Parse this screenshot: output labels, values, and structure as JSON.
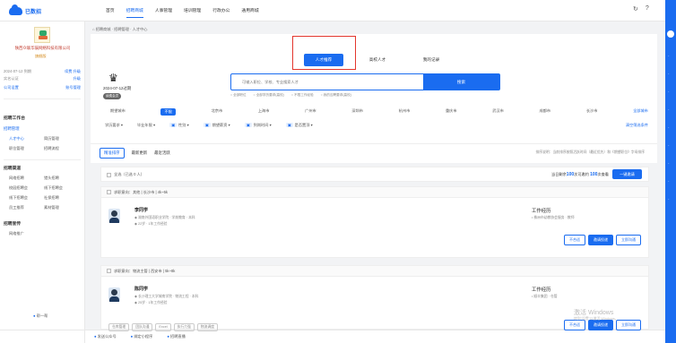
{
  "brand": {
    "logo_text": "已数招"
  },
  "nav": [
    "首页",
    "招聘商城",
    "人事管理",
    "培训管理",
    "行政办公",
    "通用商城"
  ],
  "nav_active_index": 1,
  "breadcrumb": "招聘商城 · 招聘管理 · 人才中心",
  "sidebar": {
    "company": "陕西众联华辰网络科技有限公司",
    "vip": "旗舰版",
    "date_row": {
      "left": "2024-07-12 到期",
      "right": "续费 升级"
    },
    "account_row": {
      "left": "实名认证",
      "right": "升级"
    },
    "btn_row": {
      "left": "公司设置",
      "right": "账号管理"
    },
    "section1": "招聘工作台",
    "sub1": "招聘管理",
    "grid1": [
      "人才中心",
      "简历管理",
      "职位管理",
      "招聘流程"
    ],
    "section2": "招聘渠道",
    "grid2": [
      "网络招聘",
      "猎头招聘",
      "校园招聘会",
      "线下招聘会",
      "线下招聘会",
      "社保招聘",
      "员工推荐",
      "素材管理"
    ],
    "section3": "招聘宣传",
    "grid3": [
      "网络推广"
    ],
    "bottom": "帮一帮"
  },
  "tabs": [
    "人才推荐",
    "高校人才",
    "我的记录"
  ],
  "tab_active_index": 0,
  "vip_panel": {
    "expire": "2024-07-12过期",
    "badge": "续费会员"
  },
  "search": {
    "placeholder": "可输入职位、学校、专业搜索人才",
    "button": "搜索"
  },
  "search_opts": [
    "全部职位",
    "全部学历要求(高校)",
    "不限工作经验",
    "我的应聘要求(高校)"
  ],
  "cities": [
    "期望城市",
    "不限",
    "北京市",
    "上海市",
    "广州市",
    "深圳市",
    "杭州市",
    "重庆市",
    "武汉市",
    "成都市",
    "长沙市",
    "全部城市"
  ],
  "filters": [
    "学历要求",
    "毕业年限",
    "性别",
    "期望薪资",
    "到岗时间",
    "是否置顶"
  ],
  "filter_adv": "清空筛选条件",
  "sort": {
    "buttons": [
      "精准排序",
      "最新更新",
      "最近活跃"
    ],
    "note": "排序说明：当前排序按照活跃时间（最近优先）和《期望职位》字母排序"
  },
  "selbar": {
    "label": "全选（已选 0 人）",
    "remain_prefix": "当日剩余",
    "remain_count": "100",
    "remain_mid": "次可邀约",
    "remain_count2": "100",
    "remain_suffix": "次查看",
    "button": "一键邀请"
  },
  "candidates": [
    {
      "intent": "求职意向：其他 | 长沙市 | 4k~5k",
      "name": "李同学",
      "school": "湖南外国语职业学院 · 学前教育 · 本科",
      "exp": "22岁 · 1年工作经验",
      "work": "工作经历",
      "worknote": "株洲市幼教协会服务 · 教师",
      "actions": [
        "不合适",
        "邀请投递",
        "立即沟通"
      ]
    },
    {
      "intent": "求职意向：物流主管 | 西安市 | 5k~8k",
      "name": "陈同学",
      "school": "长沙理工大学城南学院 · 物流工程 · 本科",
      "exp": "25岁 · 1年工作经验",
      "work": "工作经历",
      "worknote": "顺丰集团 · 仓管",
      "actions": [
        "不合适",
        "邀请投递",
        "立即沟通"
      ],
      "tags": [
        "仓库管理",
        "团队沟通",
        "Excel",
        "执行力强",
        "物流调度"
      ]
    }
  ],
  "bottombar": [
    "发送公众号",
    "绑定小程序",
    "招聘直播"
  ],
  "watermark": {
    "title": "激活 Windows",
    "sub": "转到\"设置\"以激活 Windows。"
  },
  "colors": {
    "accent": "#1a6cf0",
    "highlight_box": "#e3362d"
  }
}
